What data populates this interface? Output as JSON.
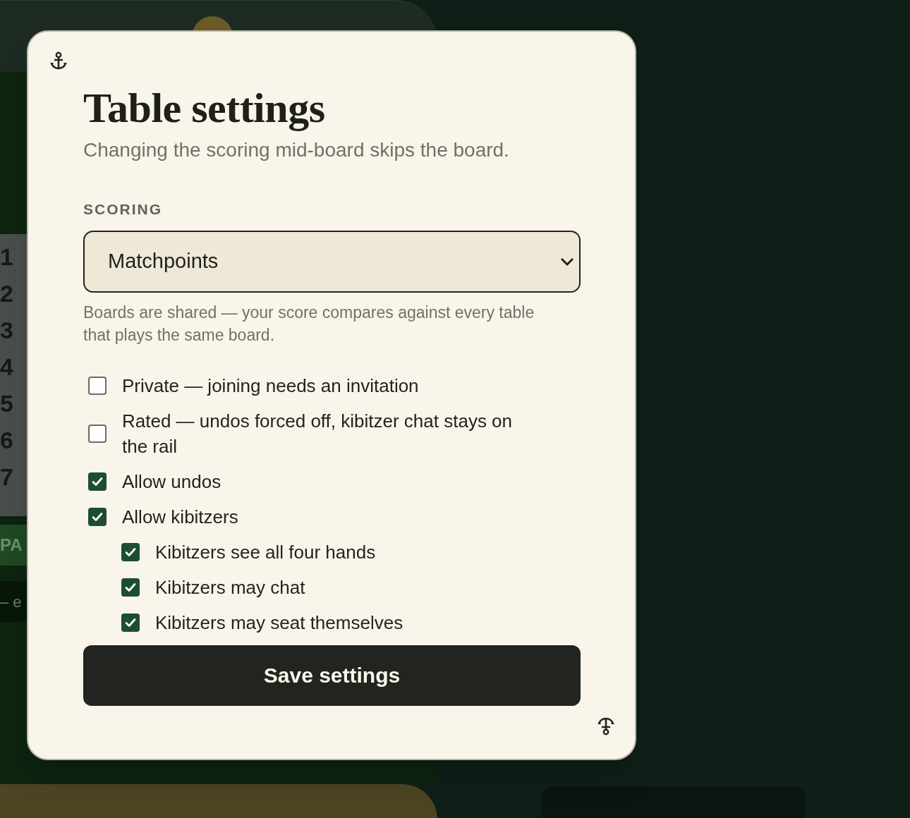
{
  "background": {
    "board_numbers": [
      "1",
      "2",
      "3",
      "4",
      "5",
      "6",
      "7"
    ],
    "bid_button": "PA",
    "note": "– e"
  },
  "dialog": {
    "title": "Table settings",
    "subtitle": "Changing the scoring mid-board skips the board.",
    "scoring": {
      "label": "SCORING",
      "value": "Matchpoints",
      "help": "Boards are shared — your score compares against every table that plays the same board."
    },
    "options": [
      {
        "label": "Private — joining needs an invitation",
        "checked": false
      },
      {
        "label": "Rated — undos forced off, kibitzer chat stays on the rail",
        "checked": false
      },
      {
        "label": "Allow undos",
        "checked": true
      },
      {
        "label": "Allow kibitzers",
        "checked": true,
        "children": [
          {
            "label": "Kibitzers see all four hands",
            "checked": true
          },
          {
            "label": "Kibitzers may chat",
            "checked": true
          },
          {
            "label": "Kibitzers may seat themselves",
            "checked": true
          }
        ]
      }
    ],
    "save_button": "Save settings"
  }
}
